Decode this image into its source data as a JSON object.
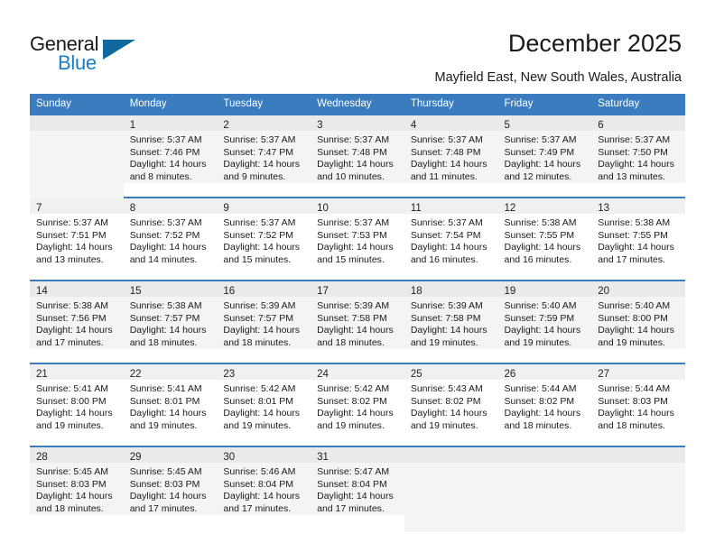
{
  "brand": {
    "name_part1": "General",
    "name_part2": "Blue",
    "triangle_icon": "brand-triangle-icon",
    "color_dark": "#1a1a1a",
    "color_blue": "#1c7cc4"
  },
  "header": {
    "title": "December 2025",
    "subtitle": "Mayfield East, New South Wales, Australia",
    "accent_color": "#3a7cbe"
  },
  "weekdays": [
    "Sunday",
    "Monday",
    "Tuesday",
    "Wednesday",
    "Thursday",
    "Friday",
    "Saturday"
  ],
  "labels": {
    "sunrise": "Sunrise:",
    "sunset": "Sunset:",
    "daylight": "Daylight:"
  },
  "weeks": [
    [
      {
        "day": "",
        "empty": true
      },
      {
        "day": "1",
        "sunrise": "Sunrise: 5:37 AM",
        "sunset": "Sunset: 7:46 PM",
        "daylight_1": "Daylight: 14 hours",
        "daylight_2": "and 8 minutes."
      },
      {
        "day": "2",
        "sunrise": "Sunrise: 5:37 AM",
        "sunset": "Sunset: 7:47 PM",
        "daylight_1": "Daylight: 14 hours",
        "daylight_2": "and 9 minutes."
      },
      {
        "day": "3",
        "sunrise": "Sunrise: 5:37 AM",
        "sunset": "Sunset: 7:48 PM",
        "daylight_1": "Daylight: 14 hours",
        "daylight_2": "and 10 minutes."
      },
      {
        "day": "4",
        "sunrise": "Sunrise: 5:37 AM",
        "sunset": "Sunset: 7:48 PM",
        "daylight_1": "Daylight: 14 hours",
        "daylight_2": "and 11 minutes."
      },
      {
        "day": "5",
        "sunrise": "Sunrise: 5:37 AM",
        "sunset": "Sunset: 7:49 PM",
        "daylight_1": "Daylight: 14 hours",
        "daylight_2": "and 12 minutes."
      },
      {
        "day": "6",
        "sunrise": "Sunrise: 5:37 AM",
        "sunset": "Sunset: 7:50 PM",
        "daylight_1": "Daylight: 14 hours",
        "daylight_2": "and 13 minutes."
      }
    ],
    [
      {
        "day": "7",
        "sunrise": "Sunrise: 5:37 AM",
        "sunset": "Sunset: 7:51 PM",
        "daylight_1": "Daylight: 14 hours",
        "daylight_2": "and 13 minutes."
      },
      {
        "day": "8",
        "sunrise": "Sunrise: 5:37 AM",
        "sunset": "Sunset: 7:52 PM",
        "daylight_1": "Daylight: 14 hours",
        "daylight_2": "and 14 minutes."
      },
      {
        "day": "9",
        "sunrise": "Sunrise: 5:37 AM",
        "sunset": "Sunset: 7:52 PM",
        "daylight_1": "Daylight: 14 hours",
        "daylight_2": "and 15 minutes."
      },
      {
        "day": "10",
        "sunrise": "Sunrise: 5:37 AM",
        "sunset": "Sunset: 7:53 PM",
        "daylight_1": "Daylight: 14 hours",
        "daylight_2": "and 15 minutes."
      },
      {
        "day": "11",
        "sunrise": "Sunrise: 5:37 AM",
        "sunset": "Sunset: 7:54 PM",
        "daylight_1": "Daylight: 14 hours",
        "daylight_2": "and 16 minutes."
      },
      {
        "day": "12",
        "sunrise": "Sunrise: 5:38 AM",
        "sunset": "Sunset: 7:55 PM",
        "daylight_1": "Daylight: 14 hours",
        "daylight_2": "and 16 minutes."
      },
      {
        "day": "13",
        "sunrise": "Sunrise: 5:38 AM",
        "sunset": "Sunset: 7:55 PM",
        "daylight_1": "Daylight: 14 hours",
        "daylight_2": "and 17 minutes."
      }
    ],
    [
      {
        "day": "14",
        "sunrise": "Sunrise: 5:38 AM",
        "sunset": "Sunset: 7:56 PM",
        "daylight_1": "Daylight: 14 hours",
        "daylight_2": "and 17 minutes."
      },
      {
        "day": "15",
        "sunrise": "Sunrise: 5:38 AM",
        "sunset": "Sunset: 7:57 PM",
        "daylight_1": "Daylight: 14 hours",
        "daylight_2": "and 18 minutes."
      },
      {
        "day": "16",
        "sunrise": "Sunrise: 5:39 AM",
        "sunset": "Sunset: 7:57 PM",
        "daylight_1": "Daylight: 14 hours",
        "daylight_2": "and 18 minutes."
      },
      {
        "day": "17",
        "sunrise": "Sunrise: 5:39 AM",
        "sunset": "Sunset: 7:58 PM",
        "daylight_1": "Daylight: 14 hours",
        "daylight_2": "and 18 minutes."
      },
      {
        "day": "18",
        "sunrise": "Sunrise: 5:39 AM",
        "sunset": "Sunset: 7:58 PM",
        "daylight_1": "Daylight: 14 hours",
        "daylight_2": "and 19 minutes."
      },
      {
        "day": "19",
        "sunrise": "Sunrise: 5:40 AM",
        "sunset": "Sunset: 7:59 PM",
        "daylight_1": "Daylight: 14 hours",
        "daylight_2": "and 19 minutes."
      },
      {
        "day": "20",
        "sunrise": "Sunrise: 5:40 AM",
        "sunset": "Sunset: 8:00 PM",
        "daylight_1": "Daylight: 14 hours",
        "daylight_2": "and 19 minutes."
      }
    ],
    [
      {
        "day": "21",
        "sunrise": "Sunrise: 5:41 AM",
        "sunset": "Sunset: 8:00 PM",
        "daylight_1": "Daylight: 14 hours",
        "daylight_2": "and 19 minutes."
      },
      {
        "day": "22",
        "sunrise": "Sunrise: 5:41 AM",
        "sunset": "Sunset: 8:01 PM",
        "daylight_1": "Daylight: 14 hours",
        "daylight_2": "and 19 minutes."
      },
      {
        "day": "23",
        "sunrise": "Sunrise: 5:42 AM",
        "sunset": "Sunset: 8:01 PM",
        "daylight_1": "Daylight: 14 hours",
        "daylight_2": "and 19 minutes."
      },
      {
        "day": "24",
        "sunrise": "Sunrise: 5:42 AM",
        "sunset": "Sunset: 8:02 PM",
        "daylight_1": "Daylight: 14 hours",
        "daylight_2": "and 19 minutes."
      },
      {
        "day": "25",
        "sunrise": "Sunrise: 5:43 AM",
        "sunset": "Sunset: 8:02 PM",
        "daylight_1": "Daylight: 14 hours",
        "daylight_2": "and 19 minutes."
      },
      {
        "day": "26",
        "sunrise": "Sunrise: 5:44 AM",
        "sunset": "Sunset: 8:02 PM",
        "daylight_1": "Daylight: 14 hours",
        "daylight_2": "and 18 minutes."
      },
      {
        "day": "27",
        "sunrise": "Sunrise: 5:44 AM",
        "sunset": "Sunset: 8:03 PM",
        "daylight_1": "Daylight: 14 hours",
        "daylight_2": "and 18 minutes."
      }
    ],
    [
      {
        "day": "28",
        "sunrise": "Sunrise: 5:45 AM",
        "sunset": "Sunset: 8:03 PM",
        "daylight_1": "Daylight: 14 hours",
        "daylight_2": "and 18 minutes."
      },
      {
        "day": "29",
        "sunrise": "Sunrise: 5:45 AM",
        "sunset": "Sunset: 8:03 PM",
        "daylight_1": "Daylight: 14 hours",
        "daylight_2": "and 17 minutes."
      },
      {
        "day": "30",
        "sunrise": "Sunrise: 5:46 AM",
        "sunset": "Sunset: 8:04 PM",
        "daylight_1": "Daylight: 14 hours",
        "daylight_2": "and 17 minutes."
      },
      {
        "day": "31",
        "sunrise": "Sunrise: 5:47 AM",
        "sunset": "Sunset: 8:04 PM",
        "daylight_1": "Daylight: 14 hours",
        "daylight_2": "and 17 minutes."
      },
      {
        "day": "",
        "empty": true
      },
      {
        "day": "",
        "empty": true
      },
      {
        "day": "",
        "empty": true
      }
    ]
  ]
}
